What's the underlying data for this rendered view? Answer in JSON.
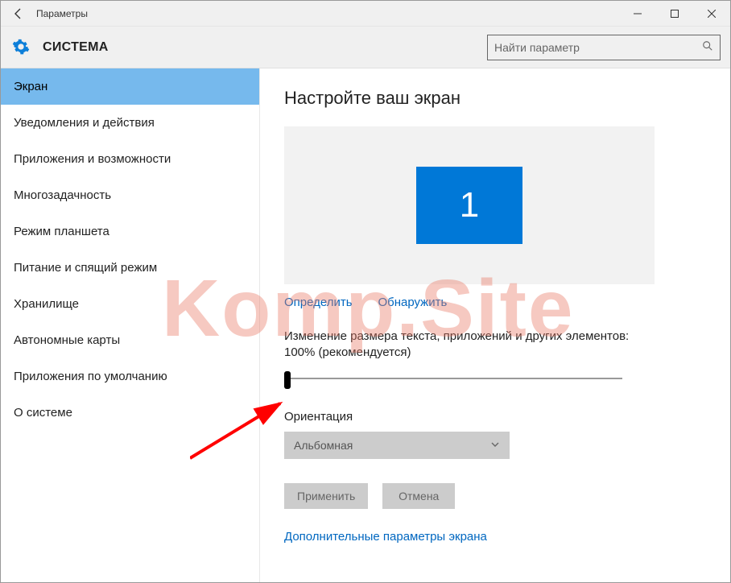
{
  "window": {
    "title": "Параметры"
  },
  "header": {
    "section": "СИСТЕМА",
    "search_placeholder": "Найти параметр"
  },
  "sidebar": {
    "items": [
      {
        "label": "Экран",
        "active": true
      },
      {
        "label": "Уведомления и действия",
        "active": false
      },
      {
        "label": "Приложения и возможности",
        "active": false
      },
      {
        "label": "Многозадачность",
        "active": false
      },
      {
        "label": "Режим планшета",
        "active": false
      },
      {
        "label": "Питание и спящий режим",
        "active": false
      },
      {
        "label": "Хранилище",
        "active": false
      },
      {
        "label": "Автономные карты",
        "active": false
      },
      {
        "label": "Приложения по умолчанию",
        "active": false
      },
      {
        "label": "О системе",
        "active": false
      }
    ]
  },
  "content": {
    "heading": "Настройте ваш экран",
    "monitor_number": "1",
    "identify_label": "Определить",
    "detect_label": "Обнаружить",
    "scale_text": "Изменение размера текста, приложений и других элементов: 100% (рекомендуется)",
    "orientation_label": "Ориентация",
    "orientation_value": "Альбомная",
    "apply_label": "Применить",
    "cancel_label": "Отмена",
    "advanced_link": "Дополнительные параметры экрана"
  },
  "watermark": "Komp.Site"
}
